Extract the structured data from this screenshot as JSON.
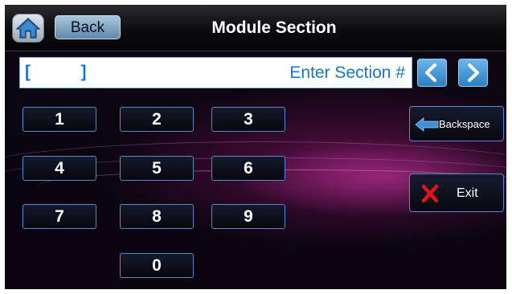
{
  "header": {
    "home_icon": "home-icon",
    "back_label": "Back",
    "title": "Module Section"
  },
  "entry": {
    "value": "[         ]",
    "prompt": "Enter Section #",
    "prev_icon": "chevron-left-icon",
    "next_icon": "chevron-right-icon"
  },
  "keypad": {
    "keys": [
      "1",
      "2",
      "3",
      "4",
      "5",
      "6",
      "7",
      "8",
      "9",
      "0"
    ]
  },
  "actions": {
    "backspace_label": "Backspace",
    "backspace_icon": "arrow-left-icon",
    "exit_label": "Exit",
    "exit_icon": "red-x-icon"
  },
  "colors": {
    "accent_blue": "#1976c6",
    "key_border": "#5f86c8",
    "exit_red": "#e0141e",
    "backspace_arrow": "#3d8fd6"
  }
}
